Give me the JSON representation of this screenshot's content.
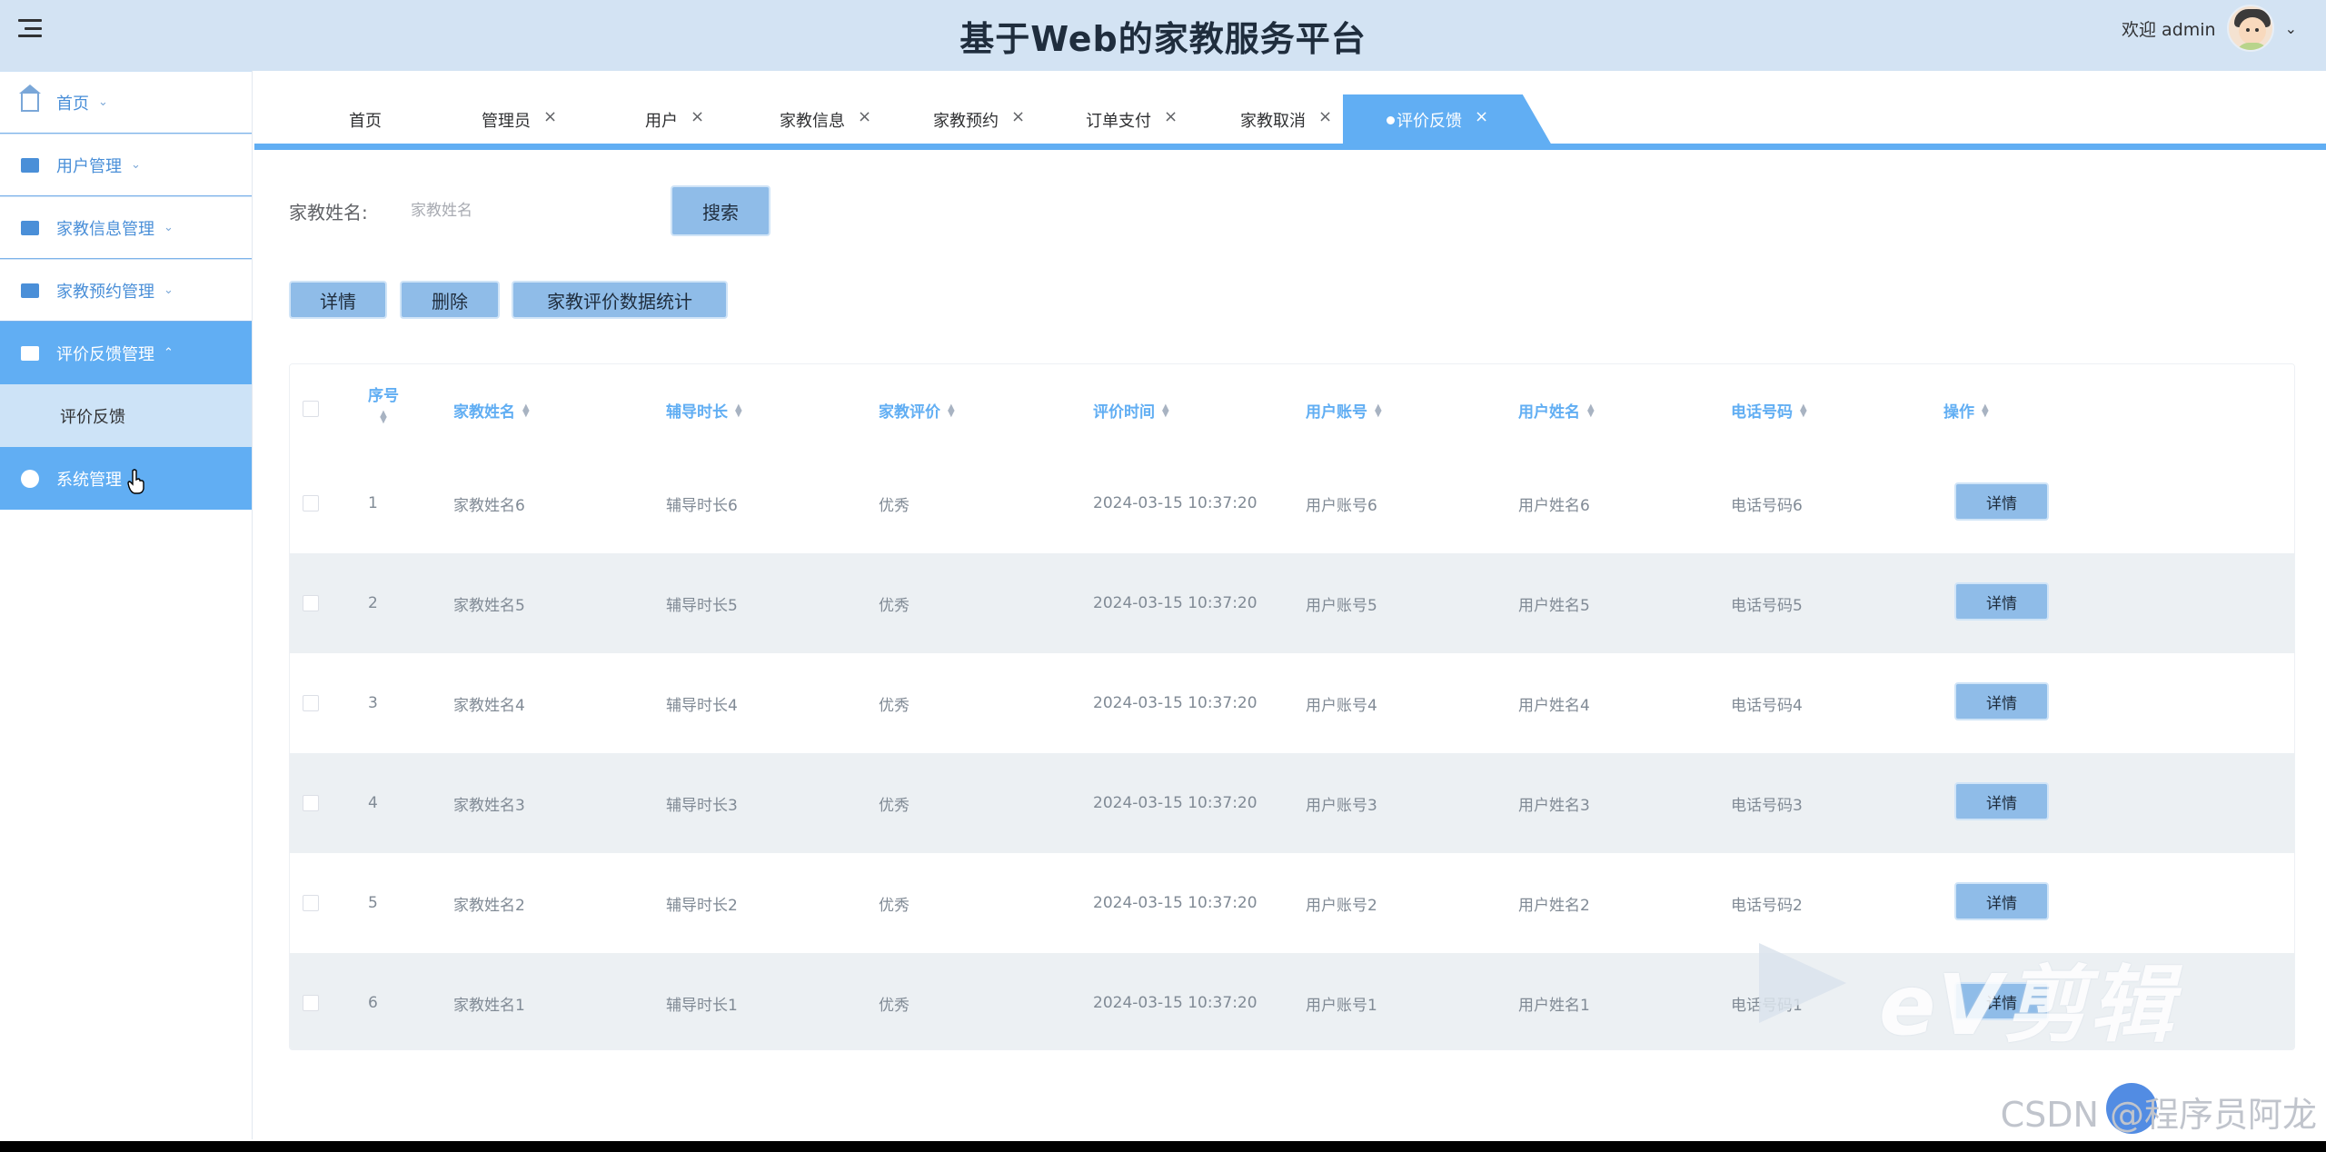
{
  "header": {
    "title": "基于Web的家教服务平台",
    "welcome": "欢迎 admin",
    "caret": "⌄"
  },
  "sidebar": {
    "items": [
      {
        "label": "首页",
        "chev": "⌄"
      },
      {
        "label": "用户管理",
        "chev": "⌄"
      },
      {
        "label": "家教信息管理",
        "chev": "⌄"
      },
      {
        "label": "家教预约管理",
        "chev": "⌄"
      },
      {
        "label": "评价反馈管理",
        "chev": "⌃"
      },
      {
        "label": "系统管理"
      }
    ],
    "submenu": {
      "label": "评价反馈"
    }
  },
  "tabs": [
    {
      "label": "首页",
      "close": ""
    },
    {
      "label": "管理员",
      "close": "×"
    },
    {
      "label": "用户",
      "close": "×"
    },
    {
      "label": "家教信息",
      "close": "×"
    },
    {
      "label": "家教预约",
      "close": "×"
    },
    {
      "label": "订单支付",
      "close": "×"
    },
    {
      "label": "家教取消",
      "close": "×"
    }
  ],
  "active_tab": {
    "label": "评价反馈",
    "close": "×"
  },
  "search": {
    "label": "家教姓名:",
    "placeholder": "家教姓名",
    "button": "搜索"
  },
  "toolbar": {
    "detail": "详情",
    "delete": "删除",
    "stats": "家教评价数据统计"
  },
  "table": {
    "headers": {
      "seq": "序号",
      "tutor_name": "家教姓名",
      "duration": "辅导时长",
      "rating": "家教评价",
      "time": "评价时间",
      "account": "用户账号",
      "user_name": "用户姓名",
      "phone": "电话号码",
      "ops": "操作"
    },
    "rows": [
      {
        "seq": "1",
        "tutor_name": "家教姓名6",
        "duration": "辅导时长6",
        "rating": "优秀",
        "time": "2024-03-15 10:37:20",
        "account": "用户账号6",
        "user_name": "用户姓名6",
        "phone": "电话号码6",
        "btn": "详情"
      },
      {
        "seq": "2",
        "tutor_name": "家教姓名5",
        "duration": "辅导时长5",
        "rating": "优秀",
        "time": "2024-03-15 10:37:20",
        "account": "用户账号5",
        "user_name": "用户姓名5",
        "phone": "电话号码5",
        "btn": "详情"
      },
      {
        "seq": "3",
        "tutor_name": "家教姓名4",
        "duration": "辅导时长4",
        "rating": "优秀",
        "time": "2024-03-15 10:37:20",
        "account": "用户账号4",
        "user_name": "用户姓名4",
        "phone": "电话号码4",
        "btn": "详情"
      },
      {
        "seq": "4",
        "tutor_name": "家教姓名3",
        "duration": "辅导时长3",
        "rating": "优秀",
        "time": "2024-03-15 10:37:20",
        "account": "用户账号3",
        "user_name": "用户姓名3",
        "phone": "电话号码3",
        "btn": "详情"
      },
      {
        "seq": "5",
        "tutor_name": "家教姓名2",
        "duration": "辅导时长2",
        "rating": "优秀",
        "time": "2024-03-15 10:37:20",
        "account": "用户账号2",
        "user_name": "用户姓名2",
        "phone": "电话号码2",
        "btn": "详情"
      },
      {
        "seq": "6",
        "tutor_name": "家教姓名1",
        "duration": "辅导时长1",
        "rating": "优秀",
        "time": "2024-03-15 10:37:20",
        "account": "用户账号1",
        "user_name": "用户姓名1",
        "phone": "电话号码1",
        "btn": "详情"
      }
    ]
  },
  "overlay": {
    "watermark": "eV剪辑",
    "csdn": "CSDN @程序员阿龙"
  },
  "colors": {
    "header_bg": "#d3e3f3",
    "accent": "#61aef3",
    "button_bg": "#8fbce8",
    "row_alt": "#ecf0f3"
  }
}
